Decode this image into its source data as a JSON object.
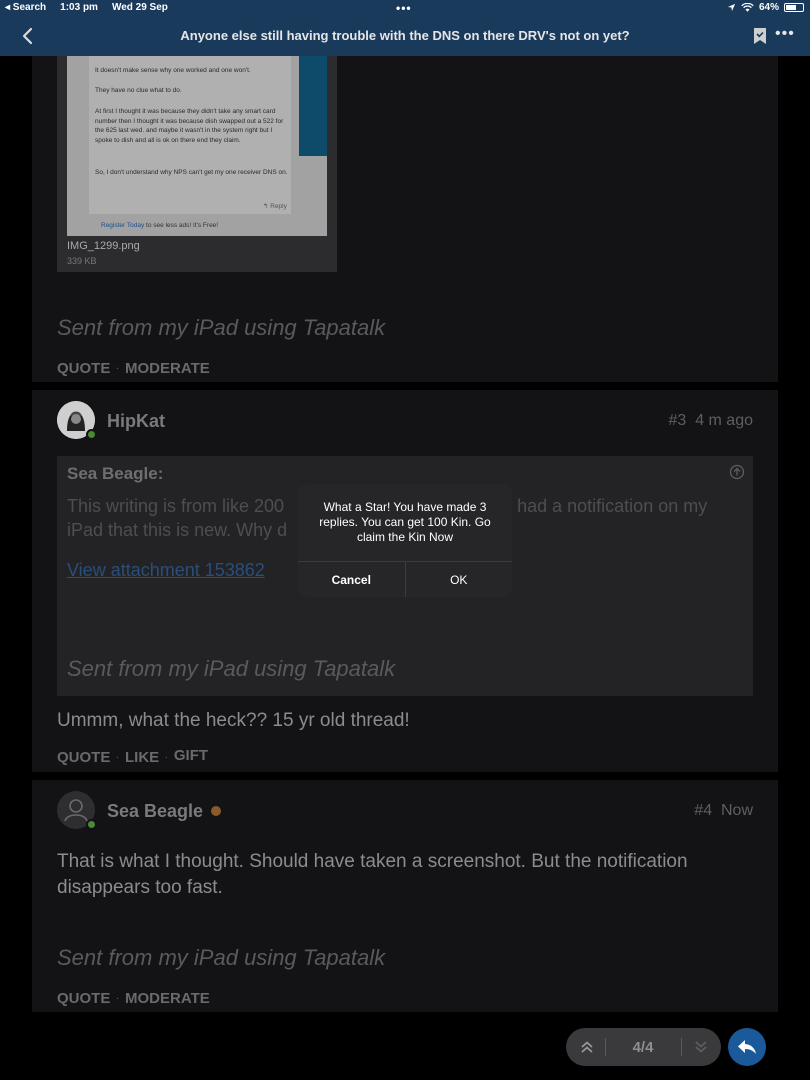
{
  "status_bar": {
    "back_app": "◂ Search",
    "time": "1:03 pm",
    "date": "Wed 29 Sep",
    "dots": "•••",
    "battery": "64%",
    "battery_level": 0.64
  },
  "navbar": {
    "title": "Anyone else still having trouble with the DNS on there DRV's not on yet?",
    "more": "•••"
  },
  "post1": {
    "screenshot_lines": [
      "It doesn't make sense why one worked and one won't.",
      "They have no clue what to do.",
      "At first I thought it was because they didn't take any smart card number then I thought it was because dish swapped out a 522 for the 625 last wed. and maybe it wasn't in the system right but I spoke to dish and all is ok on there end they claim.",
      "So, I don't understand why NPS can't get my one receiver DNS on."
    ],
    "screenshot_reply": "↰ Reply",
    "screenshot_register_link": "Register Today",
    "screenshot_register_rest": " to see less ads! It's Free!",
    "attachment_name": "IMG_1299.png",
    "attachment_size": "339 KB",
    "signature": "Sent from my iPad using Tapatalk",
    "actions": [
      "QUOTE",
      "MODERATE"
    ]
  },
  "post3": {
    "username": "HipKat",
    "post_number": "#3",
    "time_ago": "4 m ago",
    "quote_author": "Sea Beagle:",
    "quote_text": "This writing is from like 200█████████████████████████go had a notification on my iPad that this is new. Why d",
    "quote_text_left": "This writing is from like 200",
    "quote_text_right": "go had a notification on my",
    "quote_text_line2": "iPad that this is new. Why d",
    "quote_link": "View attachment 153862",
    "quote_signature": "Sent from my iPad using Tapatalk",
    "body": "Ummm, what the heck?? 15 yr old thread!",
    "actions": [
      "QUOTE",
      "LIKE",
      "GIFT"
    ]
  },
  "post4": {
    "username": "Sea Beagle",
    "post_number": "#4",
    "time_ago": "Now",
    "body": "That is what I thought. Should have taken a screenshot. But the notification disappears too fast.",
    "signature": "Sent from my iPad using Tapatalk",
    "actions": [
      "QUOTE",
      "MODERATE"
    ]
  },
  "dialog": {
    "message": "What a Star! You have made 3 replies. You can get 100 Kin. Go claim the Kin Now",
    "cancel_label": "Cancel",
    "ok_label": "OK"
  },
  "pager": {
    "count": "4/4"
  },
  "colors": {
    "header": "#1a3a5c",
    "card": "#131316",
    "online": "#4a8a32",
    "fab": "#1a5a9a"
  }
}
